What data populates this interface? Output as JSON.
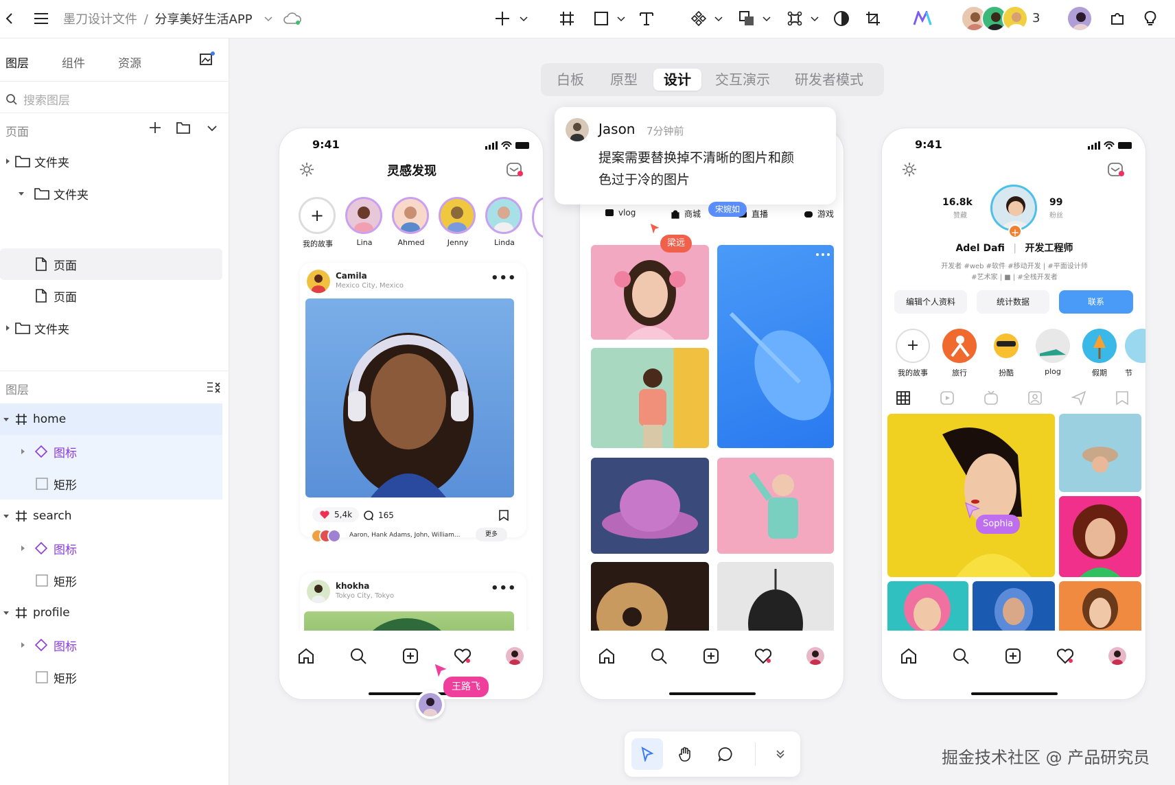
{
  "toolbar": {
    "breadcrumb_root": "墨刀设计文件",
    "breadcrumb_sep": "/",
    "breadcrumb_current": "分享美好生活APP",
    "collaborator_count": "3",
    "icons": [
      "back-icon",
      "menu-icon",
      "cloud-sync-icon",
      "add-icon",
      "frame-icon",
      "rectangle-icon",
      "text-icon",
      "component-icon",
      "boolean-icon",
      "mask-icon",
      "contrast-icon",
      "crop-icon",
      "ai-icon",
      "plugin-icon",
      "bulb-icon"
    ]
  },
  "sidebar": {
    "tabs": [
      "图层",
      "组件",
      "资源"
    ],
    "search_placeholder": "搜索图层",
    "pages_label": "页面",
    "page_tree": [
      {
        "label": "文件夹",
        "type": "folder",
        "depth": 0
      },
      {
        "label": "文件夹",
        "type": "folder",
        "depth": 1
      },
      {
        "label": "页面",
        "type": "page",
        "depth": 2,
        "selected": true
      },
      {
        "label": "页面",
        "type": "page",
        "depth": 2
      },
      {
        "label": "文件夹",
        "type": "folder",
        "depth": 0
      }
    ],
    "layers_label": "图层",
    "layers": [
      {
        "label": "home",
        "type": "frame"
      },
      {
        "label": "图标",
        "type": "component"
      },
      {
        "label": "矩形",
        "type": "rect"
      },
      {
        "label": "search",
        "type": "frame"
      },
      {
        "label": "图标",
        "type": "component"
      },
      {
        "label": "矩形",
        "type": "rect"
      },
      {
        "label": "profile",
        "type": "frame"
      },
      {
        "label": "图标",
        "type": "component"
      },
      {
        "label": "矩形",
        "type": "rect"
      }
    ]
  },
  "canvas_tabs": [
    "白板",
    "原型",
    "设计",
    "交互演示",
    "研发者模式"
  ],
  "active_canvas_tab": "设计",
  "phone1": {
    "time": "9:41",
    "title": "灵感发现",
    "stories": [
      "我的故事",
      "Lina",
      "Ahmed",
      "Jenny",
      "Linda"
    ],
    "post1": {
      "user": "Camila",
      "location": "Mexico City, Mexico",
      "likes": "5,4k",
      "comments": "165",
      "liked_by": "Aaron, Hank Adams, John, William...",
      "more": "更多"
    },
    "post2": {
      "user": "khokha",
      "location": "Tokyo City, Tokyo"
    }
  },
  "phone2": {
    "chips": [
      "vlog",
      "商城",
      "直播",
      "游戏"
    ]
  },
  "phone3": {
    "time": "9:41",
    "likes_count": "16.8k",
    "likes_label": "赞藏",
    "fans_count": "99",
    "fans_label": "粉丝",
    "name": "Adel Dafi",
    "title": "开发工程师",
    "tags_line1": "开发者 #web #软件 #移动开发 | #平面设计师",
    "tags_line2": "#艺术家 | ■ | #全栈开发者",
    "edit_btn": "编辑个人资料",
    "stats_btn": "统计数据",
    "contact_btn": "联系",
    "highlights": [
      "我的故事",
      "旅行",
      "扮酷",
      "plog",
      "假期",
      "节"
    ]
  },
  "comment": {
    "user": "Jason",
    "time": "7分钟前",
    "text_line1": "提案需要替换掉不清晰的图片和颜",
    "text_line2": "色过于冷的图片"
  },
  "cursors": [
    {
      "name": "宋婉如",
      "color": "#5a8dfa"
    },
    {
      "name": "梁远",
      "color": "#f0604a"
    },
    {
      "name": "Sophia",
      "color": "#c06ef0"
    },
    {
      "name": "王路飞",
      "color": "#f03e9c"
    }
  ],
  "watermark": "掘金技术社区 @ 产品研究员"
}
